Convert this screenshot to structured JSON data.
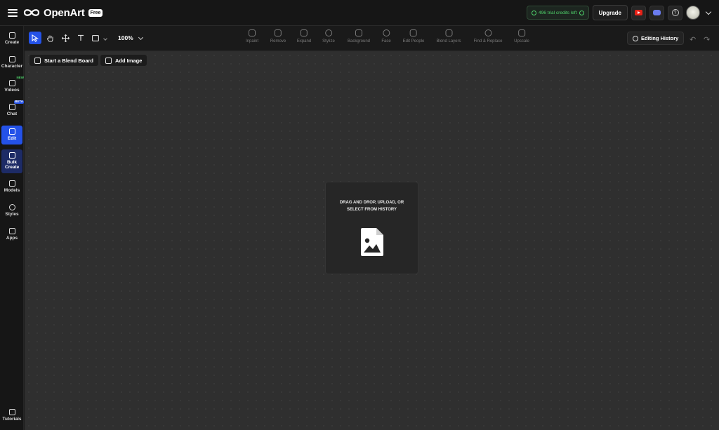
{
  "header": {
    "brand": "OpenArt",
    "plan_badge": "Free",
    "credits": "496 trial credits left",
    "upgrade_label": "Upgrade"
  },
  "sidebar": {
    "items": [
      {
        "label": "Create",
        "icon": "create-icon"
      },
      {
        "label": "Character",
        "icon": "character-icon"
      },
      {
        "label": "Videos",
        "icon": "video-icon",
        "tag": "NEW"
      },
      {
        "label": "Chat",
        "icon": "chat-icon",
        "tag": "BETA"
      },
      {
        "label": "Edit",
        "icon": "edit-icon",
        "active": true
      },
      {
        "label": "Bulk Create",
        "icon": "bulk-create-icon"
      },
      {
        "label": "Models",
        "icon": "models-icon"
      },
      {
        "label": "Styles",
        "icon": "styles-icon"
      },
      {
        "label": "Apps",
        "icon": "apps-icon"
      }
    ],
    "footer": {
      "label": "Tutorials",
      "icon": "tutorials-icon"
    }
  },
  "toolbar": {
    "zoom": "100%",
    "tools": [
      "select-tool",
      "hand-tool",
      "move-tool",
      "text-tool",
      "shape-tool"
    ],
    "edit_tools": [
      {
        "label": "Inpaint",
        "icon": "inpaint-icon"
      },
      {
        "label": "Remove",
        "icon": "remove-icon"
      },
      {
        "label": "Expand",
        "icon": "expand-icon"
      },
      {
        "label": "Stylize",
        "icon": "stylize-icon"
      },
      {
        "label": "Background",
        "icon": "background-icon"
      },
      {
        "label": "Face",
        "icon": "face-icon"
      },
      {
        "label": "Edit People",
        "icon": "edit-people-icon"
      },
      {
        "label": "Blend Layers",
        "icon": "blend-layers-icon"
      },
      {
        "label": "Find & Replace",
        "icon": "find-replace-icon"
      },
      {
        "label": "Upscale",
        "icon": "upscale-icon"
      }
    ],
    "history_label": "Editing History"
  },
  "canvas": {
    "blend_board_label": "Start a Blend Board",
    "add_image_label": "Add Image",
    "dropzone_text": "DRAG AND DROP, UPLOAD, OR SELECT FROM HISTORY"
  },
  "colors": {
    "accent": "#2452e8",
    "credits_green": "#4fd36a",
    "canvas_bg": "#2f2f2f"
  }
}
